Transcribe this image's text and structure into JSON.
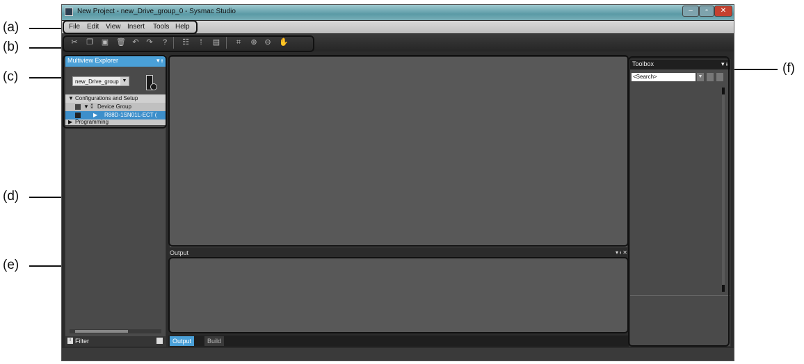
{
  "window": {
    "title": "New Project - new_Drive_group_0 - Sysmac Studio",
    "controls": [
      "–",
      "▫",
      "✕"
    ]
  },
  "menu": [
    "File",
    "Edit",
    "View",
    "Insert",
    "Tools",
    "Help"
  ],
  "toolbar_icons": [
    "cut-icon",
    "copy-icon",
    "paste-icon",
    "delete-icon",
    "undo-icon",
    "redo-icon",
    "help-icon",
    "tree-icon",
    "grid-icon",
    "window-icon",
    "fit-icon",
    "zoom-in-icon",
    "zoom-out-icon",
    "hand-icon"
  ],
  "multiview": {
    "title": "Multiview Explorer",
    "pin": "▾ ᵻ",
    "group_select": "new_Drive_group",
    "tree": {
      "config": "Configurations and Setup",
      "device_group": "Device Group",
      "device": "R88D-1SN01L-ECT (",
      "programming": "Programming"
    },
    "filter": "Filter"
  },
  "output": {
    "title": "Output",
    "controls": "▾ ᵻ ✕",
    "tabs": [
      "Output",
      "Build"
    ]
  },
  "toolbox": {
    "title": "Toolbox",
    "pin": "▾ ᵻ",
    "search_placeholder": "<Search>"
  },
  "callouts": {
    "a": "(a)",
    "b": "(b)",
    "c": "(c)",
    "d": "(d)",
    "e": "(e)",
    "f": "(f)"
  }
}
